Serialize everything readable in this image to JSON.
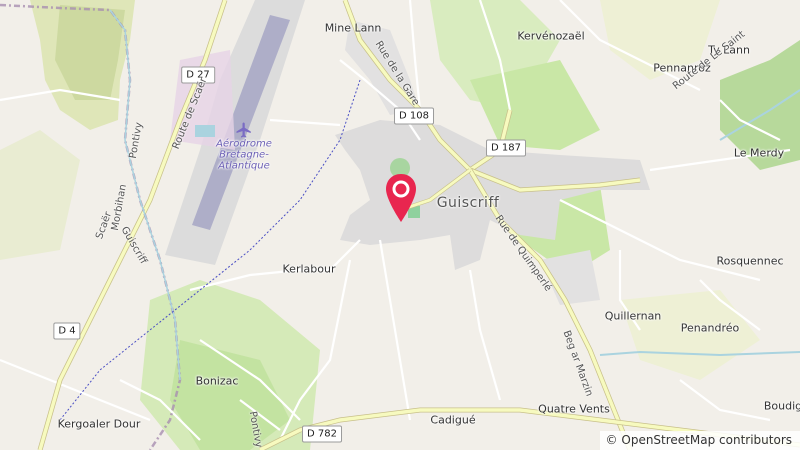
{
  "map": {
    "places": {
      "mine_lann": "Mine Lann",
      "kervenozael": "Kervénozaël",
      "ty_lann": "Ty Lann",
      "pennanroz": "Pennanroz",
      "le_merdy": "Le Merdy",
      "guiscriff": "Guiscriff",
      "kerlabour": "Kerlabour",
      "rosquennec": "Rosquennec",
      "quillernan": "Quillernan",
      "penandreo": "Penandréo",
      "bonizac": "Bonizac",
      "kergoaler_dour": "Kergoaler Dour",
      "cadigue": "Cadigué",
      "quatre_vents": "Quatre Vents",
      "boudig": "Boudig"
    },
    "aerodrome": [
      "Aérodrome",
      "Bretagne-",
      "Atlantique"
    ],
    "road_shields": {
      "d27": "D 27",
      "d108": "D 108",
      "d187": "D 187",
      "d4": "D 4",
      "d782": "D 782"
    },
    "road_names": {
      "rue_de_la_gare": "Rue de la Gare",
      "rue_de_quimperle": "Rue de Quimperlé",
      "route_de_scaer": "Route de Scaër",
      "route_de_le_saint": "Route de Le Saint",
      "beg_ar_marzin": "Beg ar Marzin",
      "pontivy_1": "Pontivy",
      "pontivy_2": "Pontivy",
      "morbihan": "Morbihan",
      "guiscriff_boundary": "Guiscriff",
      "scaer": "Scaër"
    },
    "colors": {
      "background": "#f2efe9",
      "forest": "#cfe3b3",
      "farmland": "#eef0d5",
      "grass": "#c6e6a4",
      "residential": "#e0dfdf",
      "marker": "#e8264f",
      "water": "#aad3df"
    },
    "marker_icon": "map-pin-icon",
    "aerodrome_icon": "airplane-icon"
  },
  "attribution": {
    "symbol": "©",
    "text": "OpenStreetMap contributors"
  }
}
